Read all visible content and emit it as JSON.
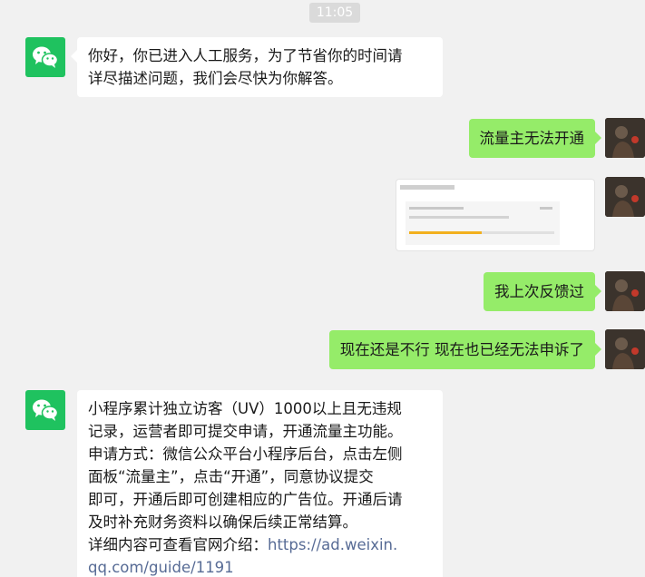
{
  "timestamp": "11:05",
  "messages": {
    "bot_greeting": "你好，你已进入人工服务，为了节省你的时间请\n详尽描述问题，我们会尽快为你解答。",
    "user_msg_1": "流量主无法开通",
    "user_msg_3": "我上次反馈过",
    "user_msg_4": "现在还是不行  现在也已经无法申诉了",
    "bot_answer_text": "小程序累计独立访客（UV）1000以上且无违规\n记录，运营者即可提交申请，开通流量主功能。\n申请方式：微信公众平台小程序后台，点击左侧\n面板“流量主”，点击“开通”，同意协议提交\n即可，开通后即可创建相应的广告位。开通后请\n及时补充财务资料以确保后续正常结算。\n详细内容可查看官网介绍：",
    "bot_answer_link": "https://ad.weixin.\nqq.com/guide/1191"
  },
  "icons": {
    "bot_avatar": "wechat-logo-icon",
    "user_avatar": "user-photo-avatar"
  },
  "colors": {
    "background": "#f1f1f1",
    "user_bubble": "#95ec69",
    "bot_bubble": "#ffffff",
    "wechat_green": "#1fc25f",
    "link": "#576b95",
    "progress": "#f2b01e"
  },
  "screenshot_card": {
    "progress_fraction": 0.5
  }
}
